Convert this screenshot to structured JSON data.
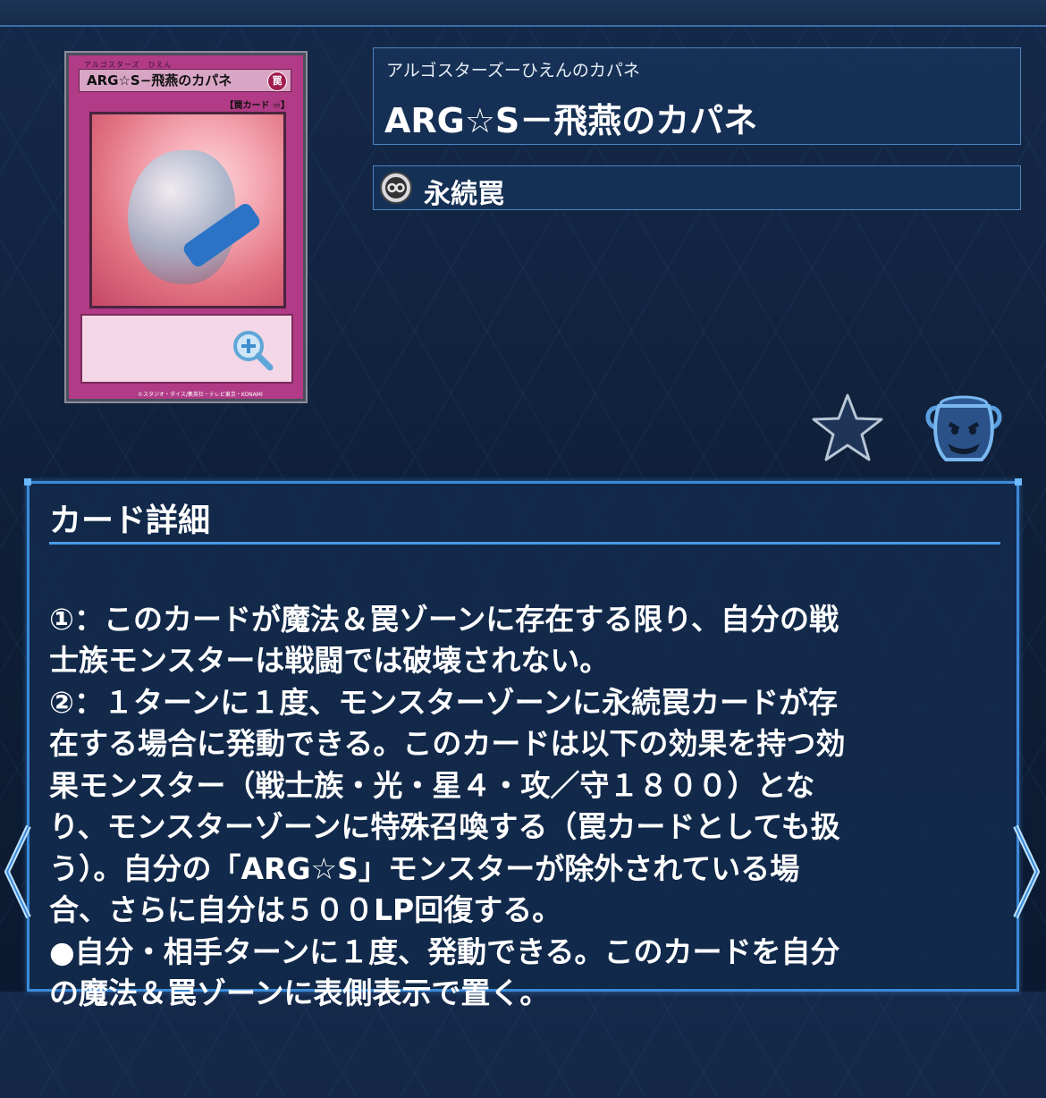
{
  "card_image": {
    "ruby": "アルゴスターズ　ひえん",
    "name": "ARG☆S−飛燕のカパネ",
    "attribute": "罠",
    "type_line": "【罠カード ♾】",
    "copyright": "©スタジオ・ダイス/集英社・テレビ東京・KONAMI"
  },
  "card": {
    "ruby": "アルゴスターズーひえんのカパネ",
    "name": "ARG☆S－飛燕のカパネ",
    "type_icon": "continuous-icon",
    "type": "永続罠"
  },
  "detail": {
    "title": "カード詳細",
    "text_lines": [
      "①：このカードが魔法＆罠ゾーンに存在する限り、自分の戦",
      "士族モンスターは戦闘では破壊されない。",
      "②：１ターンに１度、モンスターゾーンに永続罠カードが存",
      "在する場合に発動できる。このカードは以下の効果を持つ効",
      "果モンスター（戦士族・光・星４・攻／守１８００）とな",
      "り、モンスターゾーンに特殊召喚する（罠カードとしても扱",
      "う）。自分の「ARG☆S」モンスターが除外されている場",
      "合、さらに自分は５００LP回復する。",
      "●自分・相手ターンに１度、発動できる。このカードを自分",
      "の魔法＆罠ゾーンに表側表示で置く。"
    ]
  },
  "icons": [
    "zoom-icon",
    "star-icon",
    "pot-icon",
    "continuous-icon",
    "prev-arrow-icon",
    "next-arrow-icon"
  ],
  "colors": {
    "accent": "#3b8ad9",
    "trap_card": "#b13b86",
    "background": "#0f2138"
  }
}
